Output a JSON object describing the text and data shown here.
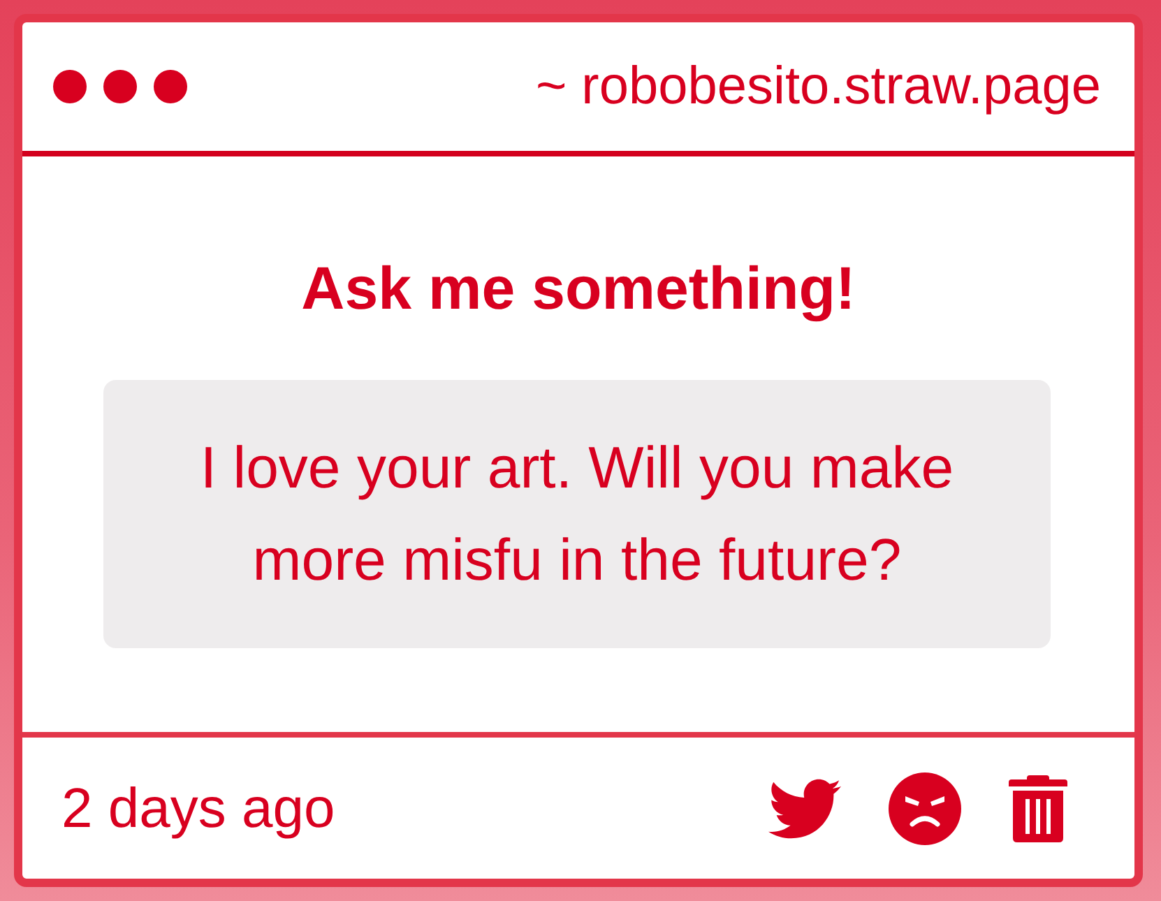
{
  "window": {
    "address": "~ robobesito.straw.page"
  },
  "content": {
    "heading": "Ask me something!",
    "question": "I love your art. Will you make more misfu in the future?"
  },
  "footer": {
    "time": "2 days ago"
  }
}
